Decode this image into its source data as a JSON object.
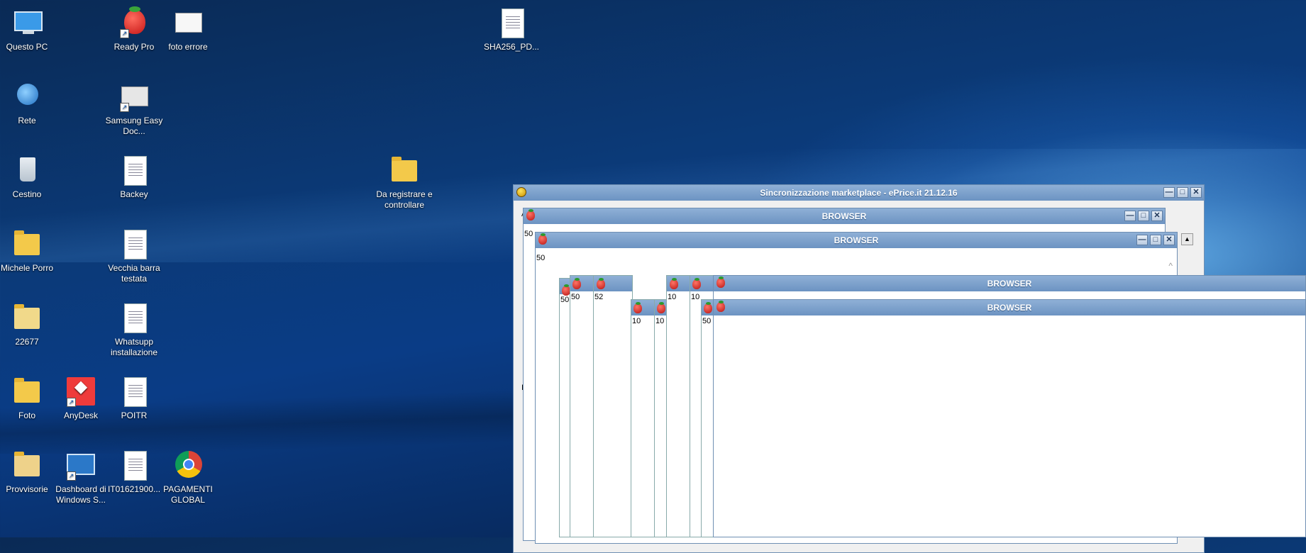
{
  "desktop": {
    "icons": [
      {
        "label": "Questo PC",
        "icon": "computer-icon"
      },
      {
        "label": "Ready Pro",
        "icon": "strawberry-icon"
      },
      {
        "label": "foto errore",
        "icon": "image-file-icon"
      },
      {
        "label": "SHA256_PD...",
        "icon": "document-icon"
      },
      {
        "label": "Rete",
        "icon": "network-icon"
      },
      {
        "label": "Samsung Easy Doc...",
        "icon": "scanner-icon"
      },
      {
        "label": "Cestino",
        "icon": "recycle-bin-icon"
      },
      {
        "label": "Backey",
        "icon": "document-icon"
      },
      {
        "label": "Da registrare e controllare",
        "icon": "folder-icon"
      },
      {
        "label": "Michele Porro",
        "icon": "user-folder-icon"
      },
      {
        "label": "Vecchia barra testata",
        "icon": "document-icon"
      },
      {
        "label": "22677",
        "icon": "folder-icon"
      },
      {
        "label": "Whatsupp installazione",
        "icon": "document-icon"
      },
      {
        "label": "Foto",
        "icon": "folder-icon"
      },
      {
        "label": "AnyDesk",
        "icon": "anydesk-icon"
      },
      {
        "label": "POITR",
        "icon": "document-icon"
      },
      {
        "label": "Provvisorie",
        "icon": "folder-icon"
      },
      {
        "label": "Dashboard di Windows S...",
        "icon": "dashboard-icon"
      },
      {
        "label": "IT01621900...",
        "icon": "xml-file-icon"
      },
      {
        "label": "PAGAMENTI GLOBAL",
        "icon": "chrome-icon"
      }
    ]
  },
  "app_window": {
    "title": "Sincronizzazione marketplace - ePrice.it 21.12.16",
    "minimize": "—",
    "maximize": "□",
    "close": "✕",
    "side_chars": [
      "A",
      "I"
    ]
  },
  "browsers": {
    "title": "BROWSER",
    "texts": [
      "50",
      "50",
      "50",
      "50",
      "52",
      "10",
      "10",
      "10",
      "10",
      "50"
    ]
  }
}
